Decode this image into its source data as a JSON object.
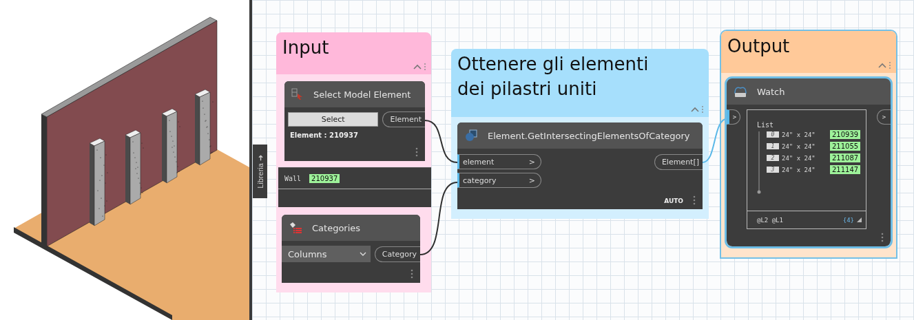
{
  "library_tab": {
    "label": "Libreria",
    "arrow": "➜"
  },
  "groups": [
    {
      "title": "Input",
      "color": "#ffb8da"
    },
    {
      "title": "Ottenere gli elementi dei pilastri uniti",
      "color": "#a6dffc"
    },
    {
      "title": "Output",
      "color": "#ffc999"
    }
  ],
  "select_node": {
    "title": "Select Model Element",
    "button": "Select",
    "output": "Element",
    "info": "Element : 210937"
  },
  "preview": {
    "label": "Wall",
    "value": "210937"
  },
  "categories_node": {
    "title": "Categories",
    "value": "Columns",
    "output": "Category"
  },
  "function_node": {
    "title": "Element.GetIntersectingElementsOfCategory",
    "inputs": [
      {
        "name": "element",
        "arrow": ">"
      },
      {
        "name": "category",
        "arrow": ">"
      }
    ],
    "output": "Element[]",
    "lacing": "AUTO"
  },
  "watch_node": {
    "title": "Watch",
    "input_port": ">",
    "output_port": ">",
    "list_label": "List",
    "items": [
      {
        "index": "0",
        "text": "24\" x 24\"",
        "value": "210939"
      },
      {
        "index": "1",
        "text": "24\" x 24\"",
        "value": "211055"
      },
      {
        "index": "2",
        "text": "24\" x 24\"",
        "value": "211087"
      },
      {
        "index": "3",
        "text": "24\" x 24\"",
        "value": "211147"
      }
    ],
    "levels": "@L2 @L1",
    "count": "{4}"
  }
}
